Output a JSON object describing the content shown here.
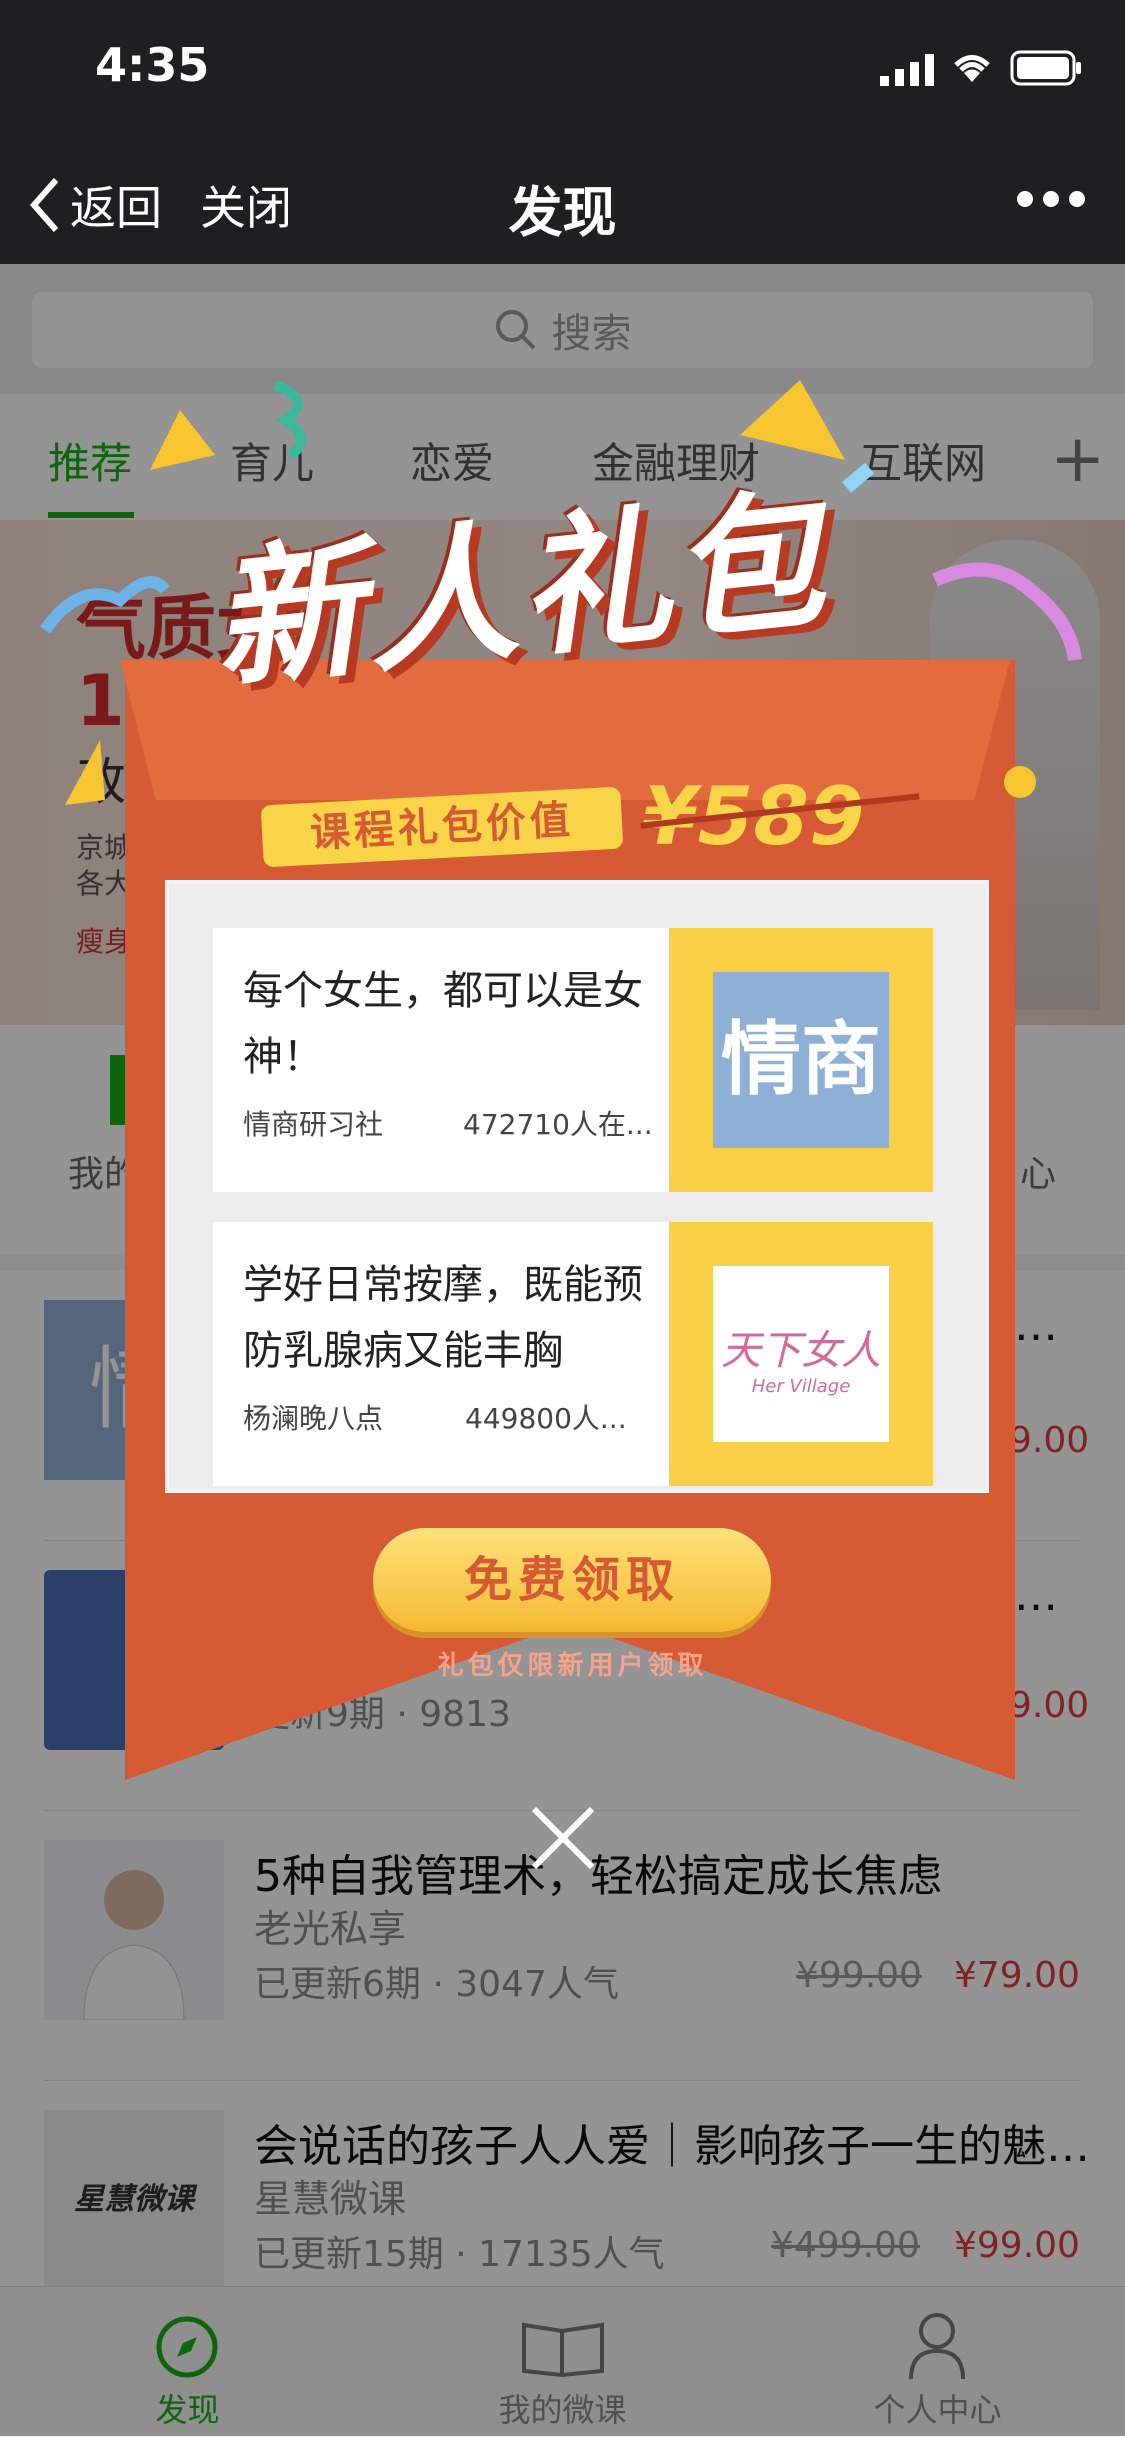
{
  "status": {
    "time": "4:35"
  },
  "nav": {
    "back": "返回",
    "close": "关闭",
    "title": "发现"
  },
  "search": {
    "placeholder": "搜索"
  },
  "tabs": [
    {
      "label": "推荐",
      "active": true
    },
    {
      "label": "育儿"
    },
    {
      "label": "恋爱"
    },
    {
      "label": "金融理财"
    },
    {
      "label": "互联网"
    }
  ],
  "banner": {
    "line1": "气质女",
    "line2": "10",
    "line3": "改",
    "line4a": "京城",
    "line4b": "各大",
    "line5": "瘦身"
  },
  "shortcuts": [
    {
      "label": "我的"
    },
    {
      "label": "心"
    }
  ],
  "list": [
    {
      "title": "…",
      "author": "",
      "meta": "",
      "old_price": "",
      "price": "9.00",
      "thumb_text": "情"
    },
    {
      "title": "…",
      "author": "",
      "meta": "更新9期 · 9813",
      "old_price": "",
      "price": "9.00"
    },
    {
      "title": "5种自我管理术，轻松搞定成长焦虑",
      "author": "老光私享",
      "meta": "已更新6期 · 3047人气",
      "old_price": "¥99.00",
      "price": "¥79.00"
    },
    {
      "title": "会说话的孩子人人爱｜影响孩子一生的魅…",
      "author": "星慧微课",
      "meta": "已更新15期 · 17135人气",
      "old_price": "¥499.00",
      "price": "¥99.00",
      "thumb_text": "星慧微课"
    }
  ],
  "tabbar": [
    {
      "label": "发现",
      "active": true
    },
    {
      "label": "我的微课"
    },
    {
      "label": "个人中心"
    }
  ],
  "popup": {
    "title": "新人礼包",
    "value_label": "课程礼包价值",
    "value_price": "¥589",
    "courses": [
      {
        "title": "每个女生，都可以是女神！",
        "publisher": "情商研习社",
        "popularity": "472710人在...",
        "image_text": "情商"
      },
      {
        "title": "学好日常按摩，既能预防乳腺病又能丰胸",
        "publisher": "杨澜晚八点",
        "popularity": "449800人...",
        "image_text": "天下女人",
        "image_subtext": "Her Village"
      }
    ],
    "claim_button": "免费领取",
    "note": "礼包仅限新用户领取"
  },
  "colors": {
    "accent": "#1aad19",
    "popup": "#d65a33",
    "gold": "#f9d448",
    "price_red": "#e0393e"
  }
}
